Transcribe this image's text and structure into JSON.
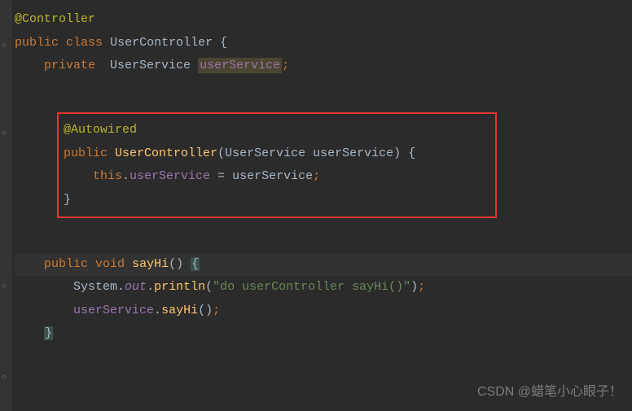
{
  "code": {
    "annotation_controller": "@Controller",
    "kw_public": "public",
    "kw_class": "class",
    "kw_private": "private",
    "kw_void": "void",
    "kw_this": "this",
    "class_name": "UserController",
    "type_userservice": "UserService",
    "field_userservice": "userService",
    "annotation_autowired": "@Autowired",
    "ctor_name": "UserController",
    "param_type": "UserService",
    "param_name": "userService",
    "assign_lhs": "userService",
    "assign_rhs": "userService",
    "method_sayhi": "sayHi",
    "system": "System",
    "out": "out",
    "println": "println",
    "string_lit": "\"do userController sayHi()\"",
    "call_target": "userService",
    "call_method": "sayHi"
  },
  "watermark": "CSDN @蜡笔小心眼子！",
  "gutter": {
    "icon1": "◇",
    "icon2": "◇",
    "icon3": "◇",
    "icon4": "◇"
  }
}
